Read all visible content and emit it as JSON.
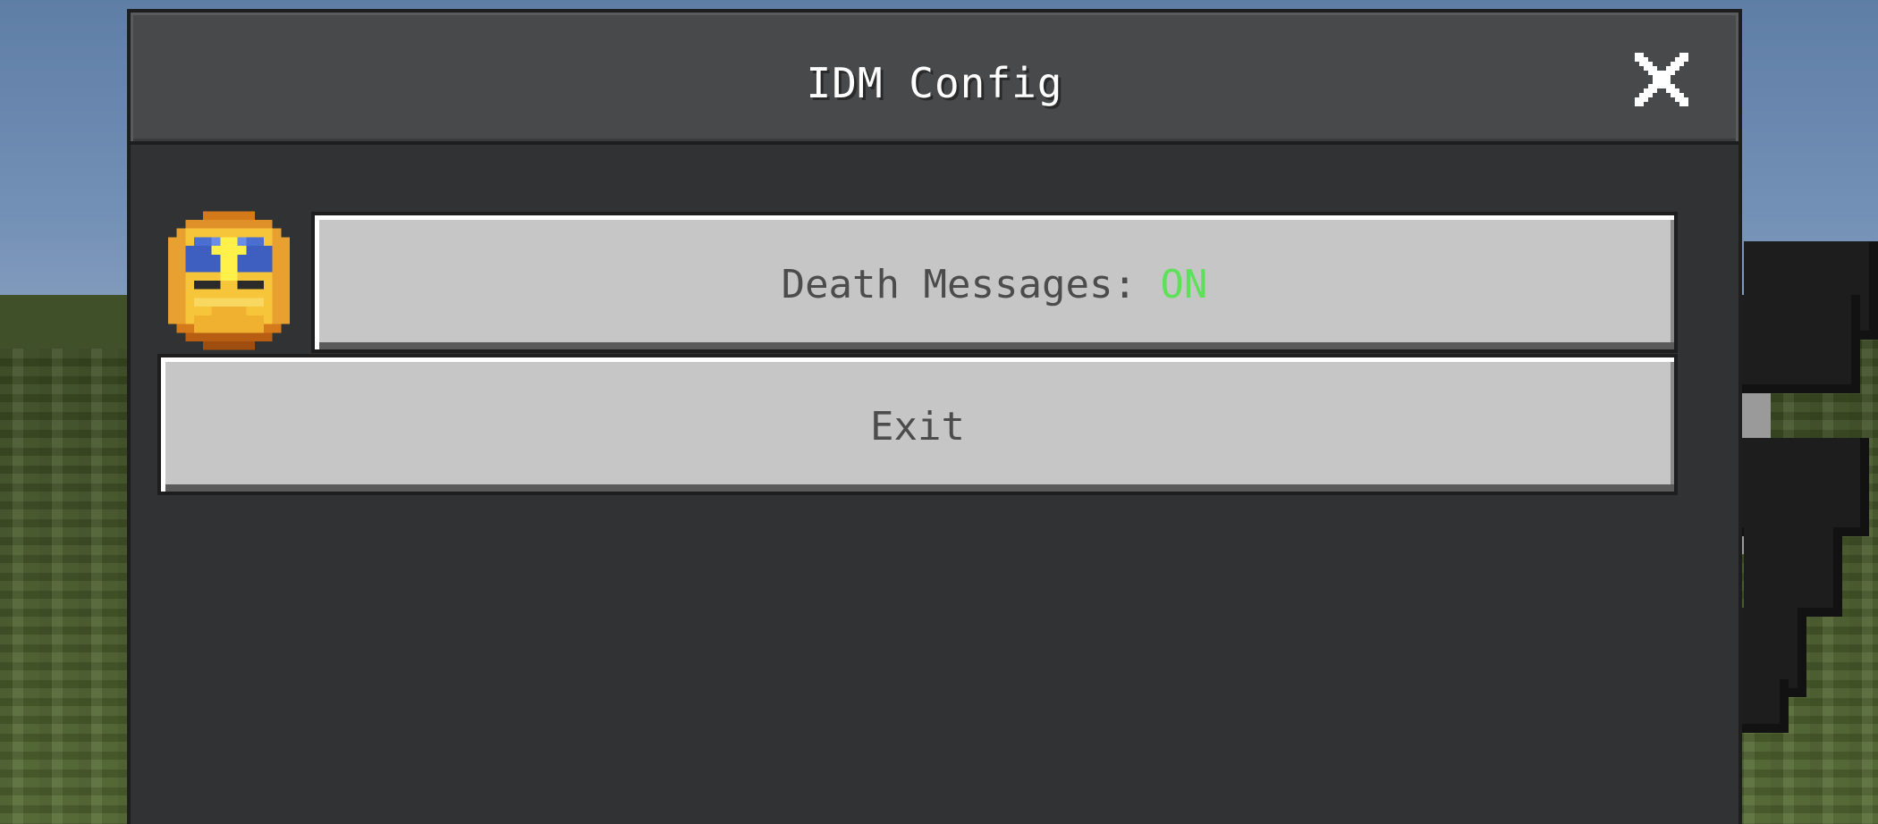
{
  "dialog": {
    "title": "IDM Config",
    "close_icon": "close-icon"
  },
  "options": {
    "avatar_icon": "golden-totem-face-icon",
    "death_messages": {
      "label": "Death Messages: ",
      "value": "ON",
      "value_color": "#5ee05a"
    },
    "exit_label": "Exit"
  },
  "colors": {
    "panel": "#313233",
    "titlebar": "#48494a",
    "button": "#c6c6c6",
    "button_text": "#4c4c4c"
  }
}
